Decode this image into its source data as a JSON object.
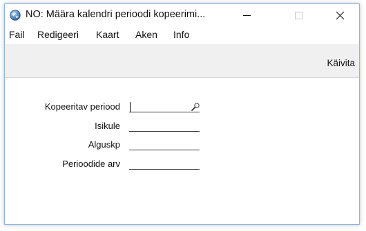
{
  "window": {
    "title": "NO: Määra kalendri perioodi kopeerimi...",
    "app_icon": "globe-icon",
    "controls": [
      "minimize-icon",
      "maximize-icon",
      "close-icon"
    ]
  },
  "menu": {
    "items": [
      "Fail",
      "Redigeeri",
      "Kaart",
      "Aken",
      "Info"
    ]
  },
  "toolbar": {
    "run_label": "Käivita"
  },
  "form": {
    "fields": [
      {
        "label": "Kopeeritav periood",
        "value": "",
        "icon": "search-icon"
      },
      {
        "label": "Isikule",
        "value": ""
      },
      {
        "label": "Alguskp",
        "value": ""
      },
      {
        "label": "Perioodide arv",
        "value": ""
      }
    ]
  },
  "colors": {
    "toolbar_bg": "#f0f0f0",
    "window_border": "#8fb4dc"
  }
}
